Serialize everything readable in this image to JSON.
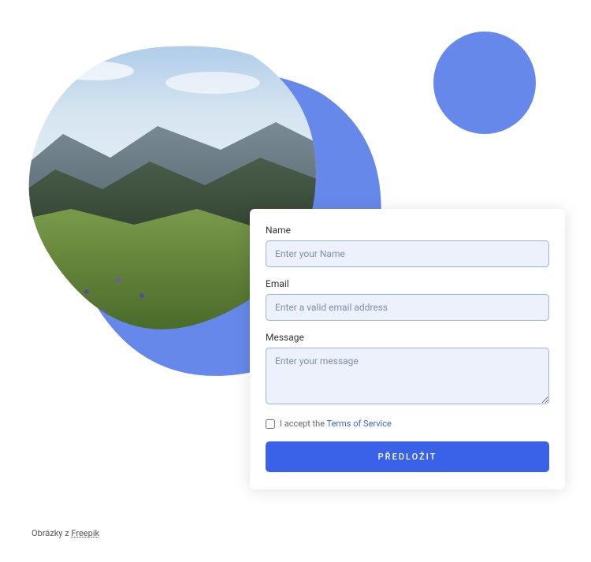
{
  "colors": {
    "accent": "#6688ea",
    "primary": "#3a62e8",
    "input_bg": "#ecf1fb",
    "input_border": "#94b3e8"
  },
  "form": {
    "name_label": "Name",
    "name_placeholder": "Enter your Name",
    "email_label": "Email",
    "email_placeholder": "Enter a valid email address",
    "message_label": "Message",
    "message_placeholder": "Enter your message",
    "accept_text": "I accept the ",
    "tos_link_text": "Terms of Service",
    "submit_label": "PŘEDLOŽIT"
  },
  "attribution": {
    "prefix": "Obrázky z ",
    "link_text": "Freepik"
  }
}
